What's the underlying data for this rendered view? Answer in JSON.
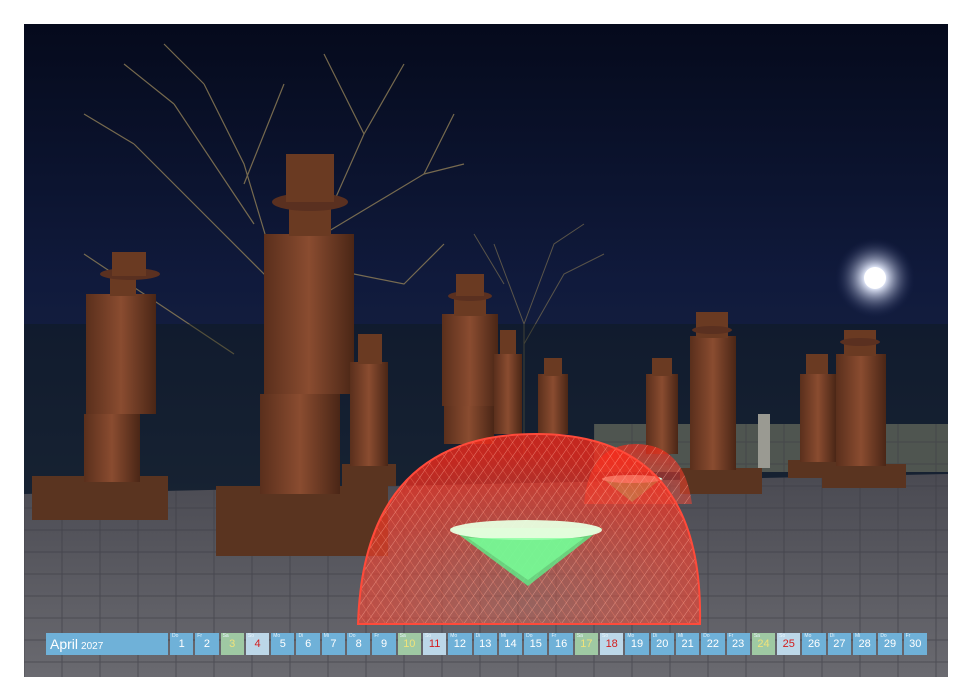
{
  "calendar": {
    "month": "April",
    "year": "2027",
    "days": [
      {
        "num": "1",
        "wd": "Do",
        "type": "weekday"
      },
      {
        "num": "2",
        "wd": "Fr",
        "type": "weekday"
      },
      {
        "num": "3",
        "wd": "Sa",
        "type": "sat"
      },
      {
        "num": "4",
        "wd": "So",
        "type": "sun"
      },
      {
        "num": "5",
        "wd": "Mo",
        "type": "weekday"
      },
      {
        "num": "6",
        "wd": "Di",
        "type": "weekday"
      },
      {
        "num": "7",
        "wd": "Mi",
        "type": "weekday"
      },
      {
        "num": "8",
        "wd": "Do",
        "type": "weekday"
      },
      {
        "num": "9",
        "wd": "Fr",
        "type": "weekday"
      },
      {
        "num": "10",
        "wd": "Sa",
        "type": "sat"
      },
      {
        "num": "11",
        "wd": "So",
        "type": "sun"
      },
      {
        "num": "12",
        "wd": "Mo",
        "type": "weekday"
      },
      {
        "num": "13",
        "wd": "Di",
        "type": "weekday"
      },
      {
        "num": "14",
        "wd": "Mi",
        "type": "weekday"
      },
      {
        "num": "15",
        "wd": "Do",
        "type": "weekday"
      },
      {
        "num": "16",
        "wd": "Fr",
        "type": "weekday"
      },
      {
        "num": "17",
        "wd": "Sa",
        "type": "sat"
      },
      {
        "num": "18",
        "wd": "So",
        "type": "sun"
      },
      {
        "num": "19",
        "wd": "Mo",
        "type": "weekday"
      },
      {
        "num": "20",
        "wd": "Di",
        "type": "weekday"
      },
      {
        "num": "21",
        "wd": "Mi",
        "type": "weekday"
      },
      {
        "num": "22",
        "wd": "Do",
        "type": "weekday"
      },
      {
        "num": "23",
        "wd": "Fr",
        "type": "weekday"
      },
      {
        "num": "24",
        "wd": "Sa",
        "type": "sat"
      },
      {
        "num": "25",
        "wd": "So",
        "type": "sun"
      },
      {
        "num": "26",
        "wd": "Mo",
        "type": "weekday"
      },
      {
        "num": "27",
        "wd": "Di",
        "type": "weekday"
      },
      {
        "num": "28",
        "wd": "Mi",
        "type": "weekday"
      },
      {
        "num": "29",
        "wd": "Do",
        "type": "weekday"
      },
      {
        "num": "30",
        "wd": "Fr",
        "type": "weekday"
      }
    ]
  },
  "colors": {
    "bar": "#6fb1d8",
    "sunday_text": "#d31c1c",
    "saturday_text": "#f0e27a",
    "sky": "#0b1430",
    "light_painting": "#ff3b2f",
    "cone_glow": "#5cf08a"
  }
}
